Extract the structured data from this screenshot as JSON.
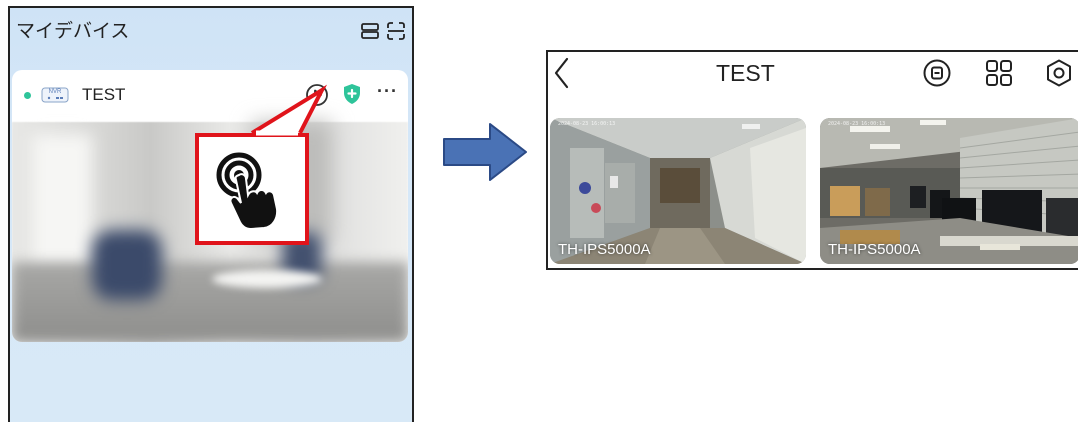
{
  "left_screen": {
    "title": "マイデバイス",
    "header_icons": [
      "list-view-icon",
      "scan-icon"
    ],
    "device": {
      "badge": "NVR",
      "name": "TEST",
      "status_color": "#2ec49a",
      "actions": [
        "play-icon",
        "shield-icon",
        "more-icon"
      ],
      "more_label": "···"
    },
    "callout_color": "#e0141b"
  },
  "arrow": {
    "color": "#4a72b5",
    "icon": "right-arrow-icon"
  },
  "right_screen": {
    "title": "TEST",
    "header_icons": [
      "back-icon",
      "playback-icon",
      "grid-layout-icon",
      "settings-icon"
    ],
    "cameras": [
      {
        "label": "TH-IPS5000A",
        "stamp": "2024-08-23 16:00:13"
      },
      {
        "label": "TH-IPS5000A",
        "stamp": "2024-08-23 16:00:13"
      }
    ]
  }
}
